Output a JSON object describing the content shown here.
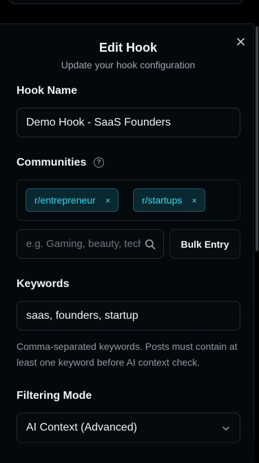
{
  "modal": {
    "title": "Edit Hook",
    "subtitle": "Update your hook configuration",
    "close_icon": "close-icon"
  },
  "hook_name": {
    "label": "Hook Name",
    "value": "Demo Hook - SaaS Founders"
  },
  "communities": {
    "label": "Communities",
    "help_icon": "?",
    "tags": [
      {
        "label": "r/entrepreneur",
        "remove_icon": "×"
      },
      {
        "label": "r/startups",
        "remove_icon": "×"
      }
    ],
    "search_placeholder": "e.g. Gaming, beauty, tech",
    "bulk_entry_label": "Bulk Entry"
  },
  "keywords": {
    "label": "Keywords",
    "value": "saas, founders, startup",
    "hint": "Comma-separated keywords. Posts must contain at least one keyword before AI context check."
  },
  "filtering_mode": {
    "label": "Filtering Mode",
    "selected": "AI Context (Advanced)"
  },
  "colors": {
    "background": "#000000",
    "panel": "#05080b",
    "accent": "#38d8ee",
    "tag_bg": "#0a2830",
    "border": "#1e3039",
    "muted_text": "#8d9aa4"
  }
}
